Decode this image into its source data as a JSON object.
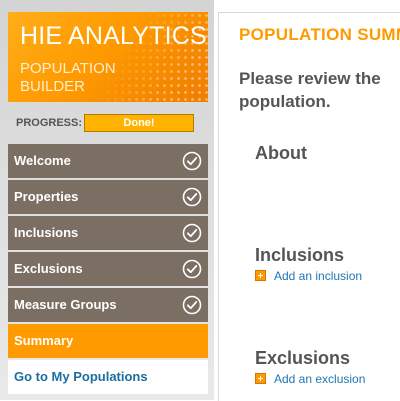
{
  "brand": {
    "title": "HIE ANALYTICS",
    "subtitle_line1": "POPULATION",
    "subtitle_line2": "BUILDER"
  },
  "progress": {
    "label": "PROGRESS:",
    "status": "Done!"
  },
  "sidebar": {
    "items": [
      {
        "label": "Welcome",
        "completed": true,
        "icon": "check-circle-icon"
      },
      {
        "label": "Properties",
        "completed": true,
        "icon": "check-circle-icon"
      },
      {
        "label": "Inclusions",
        "completed": true,
        "icon": "check-circle-icon"
      },
      {
        "label": "Exclusions",
        "completed": true,
        "icon": "check-circle-icon"
      },
      {
        "label": "Measure Groups",
        "completed": true,
        "icon": "check-circle-icon"
      },
      {
        "label": "Summary",
        "active": true
      }
    ],
    "link": "Go to My Populations"
  },
  "main": {
    "title": "POPULATION SUMMARY",
    "review_line1": "Please review the",
    "review_line2": "population.",
    "sections": [
      {
        "heading": "About"
      },
      {
        "heading": "Inclusions",
        "add_label": "Add an inclusion",
        "icon": "plus-icon"
      },
      {
        "heading": "Exclusions",
        "add_label": "Add an exclusion",
        "icon": "plus-icon"
      }
    ]
  },
  "colors": {
    "accent_orange": "#ff9a00",
    "nav_brown": "#7b6e63",
    "link_blue": "#1d6f9f",
    "heading_gray": "#555555"
  }
}
